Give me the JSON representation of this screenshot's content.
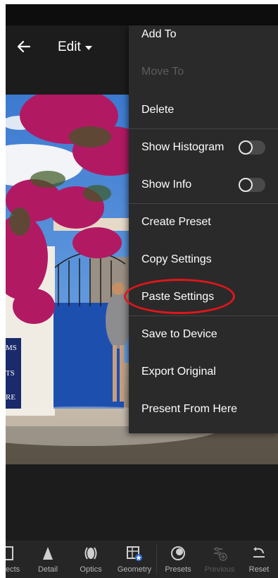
{
  "header": {
    "title": "Edit"
  },
  "menu": {
    "items": [
      {
        "label": "Add To",
        "enabled": true
      },
      {
        "label": "Move To",
        "enabled": false
      },
      {
        "label": "Delete",
        "enabled": true
      },
      {
        "label": "Show Histogram",
        "enabled": true,
        "toggle": false
      },
      {
        "label": "Show Info",
        "enabled": true,
        "toggle": false
      },
      {
        "label": "Create Preset",
        "enabled": true
      },
      {
        "label": "Copy Settings",
        "enabled": true
      },
      {
        "label": "Paste Settings",
        "enabled": true,
        "highlighted": true
      },
      {
        "label": "Save to Device",
        "enabled": true
      },
      {
        "label": "Export Original",
        "enabled": true
      },
      {
        "label": "Present From Here",
        "enabled": true
      }
    ]
  },
  "toolbar": {
    "items": [
      {
        "label": "ects",
        "icon": "effects-icon",
        "enabled": true
      },
      {
        "label": "Detail",
        "icon": "detail-icon",
        "enabled": true
      },
      {
        "label": "Optics",
        "icon": "optics-icon",
        "enabled": true
      },
      {
        "label": "Geometry",
        "icon": "geometry-icon",
        "enabled": true
      },
      {
        "label": "Presets",
        "icon": "presets-icon",
        "enabled": true
      },
      {
        "label": "Previous",
        "icon": "previous-icon",
        "enabled": false
      },
      {
        "label": "Reset",
        "icon": "reset-icon",
        "enabled": true
      }
    ]
  },
  "photo": {
    "sign_text": [
      "MS",
      "TS",
      "RE"
    ]
  },
  "colors": {
    "menu_bg": "#2a2a2a",
    "highlight": "#e0161b",
    "accent": "#2f6fd6"
  }
}
